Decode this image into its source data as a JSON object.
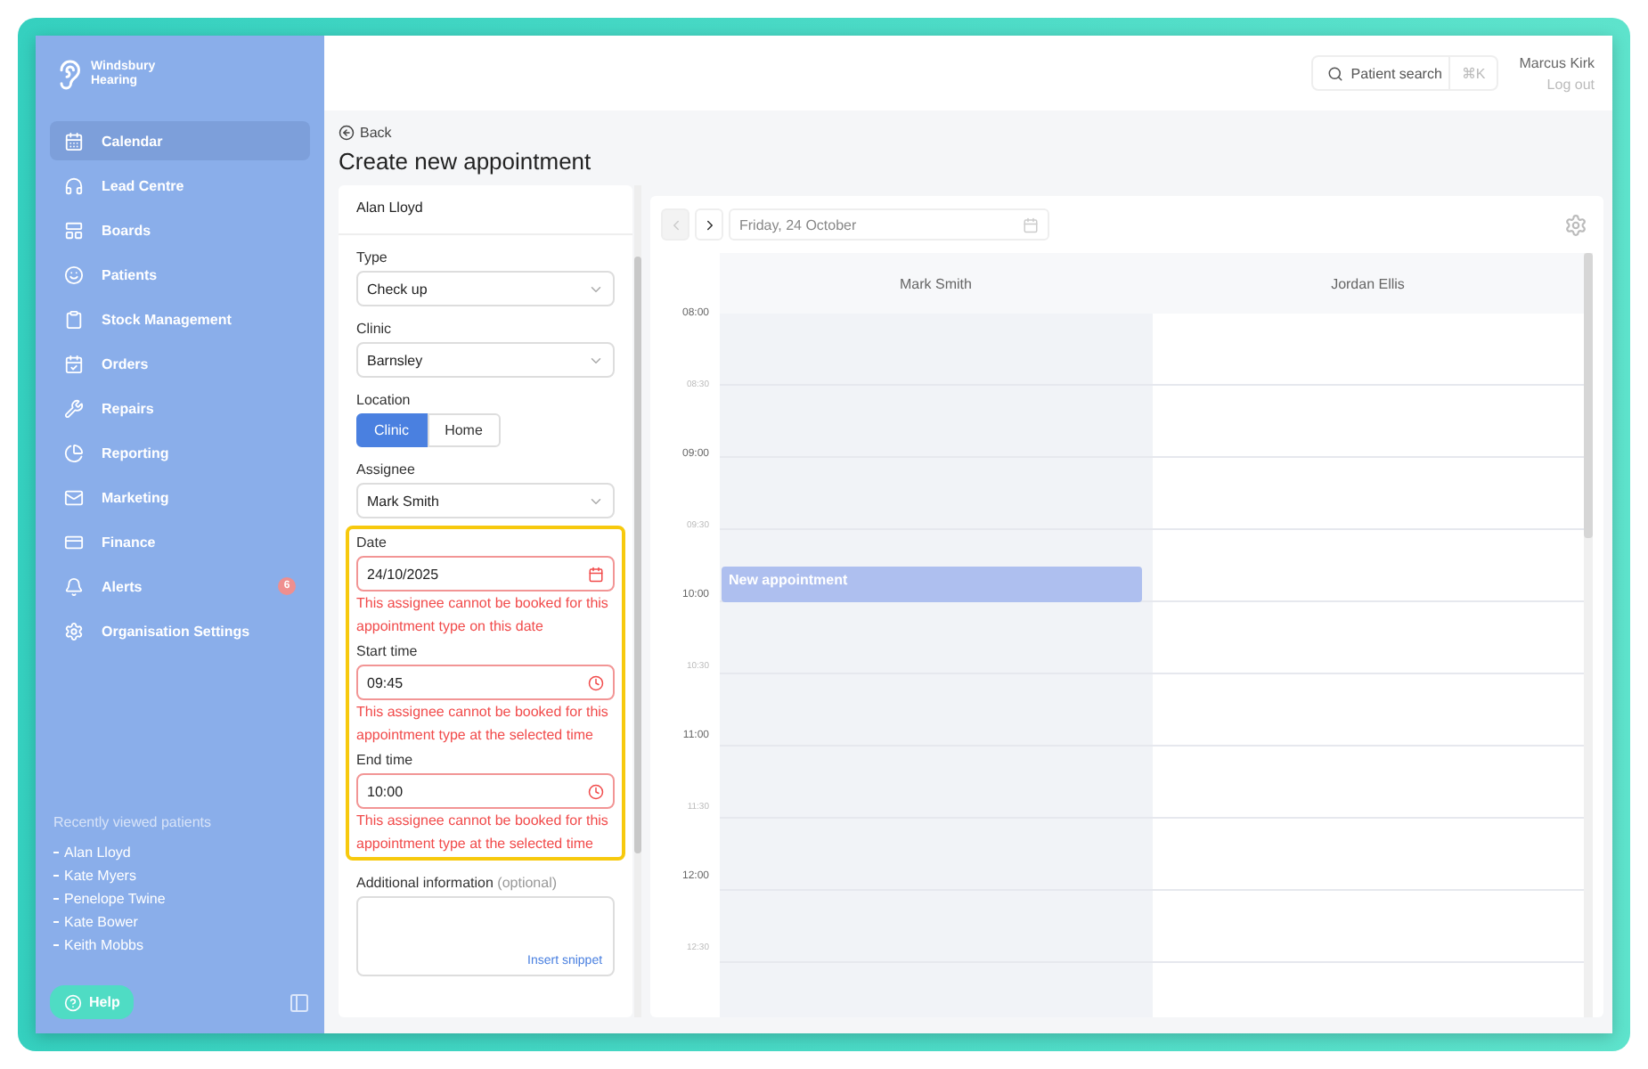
{
  "brand": {
    "name": "Windsbury Hearing"
  },
  "sidebar": {
    "items": [
      {
        "label": "Calendar",
        "selected": true
      },
      {
        "label": "Lead Centre",
        "selected": false
      },
      {
        "label": "Boards",
        "selected": false
      },
      {
        "label": "Patients",
        "selected": false
      },
      {
        "label": "Stock Management",
        "selected": false
      },
      {
        "label": "Orders",
        "selected": false
      },
      {
        "label": "Repairs",
        "selected": false
      },
      {
        "label": "Reporting",
        "selected": false
      },
      {
        "label": "Marketing",
        "selected": false
      },
      {
        "label": "Finance",
        "selected": false
      },
      {
        "label": "Alerts",
        "selected": false,
        "badge": "6"
      },
      {
        "label": "Organisation Settings",
        "selected": false
      }
    ],
    "recent_title": "Recently viewed patients",
    "recent": [
      "Alan Lloyd",
      "Kate Myers",
      "Penelope Twine",
      "Kate Bower",
      "Keith Mobbs"
    ],
    "help": "Help"
  },
  "topbar": {
    "search": "Patient search",
    "shortcut": "⌘K",
    "user": "Marcus Kirk",
    "logout": "Log out"
  },
  "form": {
    "back": "Back",
    "title": "Create new appointment",
    "patient": "Alan Lloyd",
    "fields": [
      {
        "kind": "select",
        "label": "Type",
        "value": "Check up"
      },
      {
        "kind": "select",
        "label": "Clinic",
        "value": "Barnsley"
      },
      {
        "kind": "segmented",
        "label": "Location",
        "options": [
          {
            "label": "Clinic",
            "selected": true
          },
          {
            "label": "Home",
            "selected": false
          }
        ]
      },
      {
        "kind": "select",
        "label": "Assignee",
        "value": "Mark Smith"
      },
      {
        "kind": "group",
        "fields": [
          {
            "kind": "date",
            "label": "Date",
            "value": "24/10/2025",
            "error": "This assignee cannot be booked for this appointment type on this date"
          },
          {
            "kind": "time",
            "label": "Start time",
            "value": "09:45",
            "error": "This assignee cannot be booked for this appointment type at the selected time"
          },
          {
            "kind": "time",
            "label": "End time",
            "value": "10:00",
            "error": "This assignee cannot be booked for this appointment type at the selected time"
          }
        ]
      },
      {
        "kind": "textarea",
        "label": "Additional information",
        "optional": "(optional)",
        "action": "Insert snippet"
      }
    ]
  },
  "calendar": {
    "date": "Friday, 24 October",
    "prev_disabled": true,
    "columns": [
      {
        "name": "Mark Smith",
        "available": false,
        "appointments": [
          {
            "title": "New appointment"
          }
        ]
      },
      {
        "name": "Jordan Ellis",
        "available": true
      }
    ],
    "times": [
      {
        "label": "08:00",
        "kind": "hour"
      },
      {
        "label": "08:30",
        "kind": "half"
      },
      {
        "label": "09:00",
        "kind": "hour"
      },
      {
        "label": "09:30",
        "kind": "half"
      },
      {
        "label": "10:00",
        "kind": "hour"
      },
      {
        "label": "10:30",
        "kind": "half"
      },
      {
        "label": "11:00",
        "kind": "hour"
      },
      {
        "label": "11:30",
        "kind": "half"
      },
      {
        "label": "12:00",
        "kind": "hour"
      },
      {
        "label": "12:30",
        "kind": "half"
      }
    ]
  }
}
